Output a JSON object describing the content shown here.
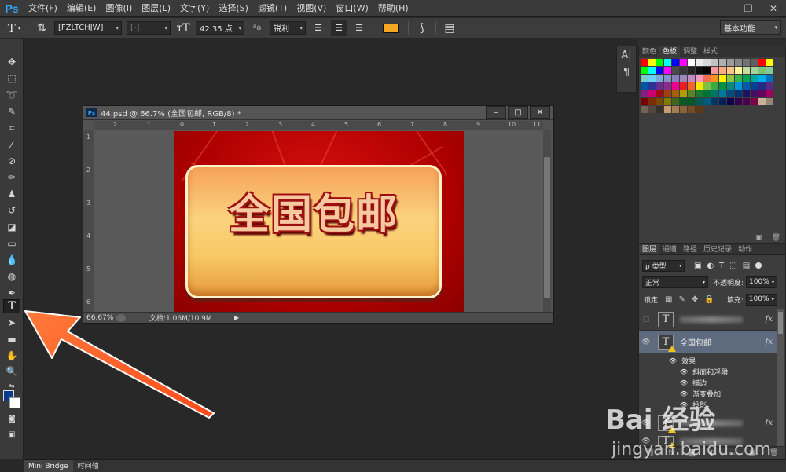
{
  "app": {
    "logo": "Ps"
  },
  "menu": [
    "文件(F)",
    "编辑(E)",
    "图像(I)",
    "图层(L)",
    "文字(Y)",
    "选择(S)",
    "滤镜(T)",
    "视图(V)",
    "窗口(W)",
    "帮助(H)"
  ],
  "window_controls": {
    "minimize": "–",
    "restore": "❐",
    "close": "✕"
  },
  "options": {
    "font_family": "[FZLTCHJW]",
    "font_style": "[-]",
    "font_size": "42.35 点",
    "aa_label": "ªa",
    "antialias": "锐利",
    "swatch_color": "#f5a623",
    "workspace": "基本功能"
  },
  "document": {
    "title": "44.psd @ 66.7% (全国包邮, RGB/8) *",
    "ruler_h": [
      "2",
      "1",
      "0",
      "1",
      "2",
      "3",
      "4",
      "5",
      "6",
      "7",
      "8",
      "9",
      "10",
      "11"
    ],
    "ruler_v": [
      "1",
      "2",
      "3",
      "4",
      "5",
      "6"
    ],
    "zoom": "66.67%",
    "doc_size": "文档:1.06M/10.9M",
    "art_text": "全国包邮"
  },
  "colors": {
    "foreground": "#0b3b8c",
    "background": "#ffffff"
  },
  "swatches_panel": {
    "tabs": [
      "颜色",
      "色板",
      "调整",
      "样式"
    ],
    "active_tab": 1,
    "swatches": [
      "#ff0000",
      "#ffff00",
      "#00ff00",
      "#00ffff",
      "#0000ff",
      "#ff00ff",
      "#ffffff",
      "#ebebeb",
      "#d7d7d7",
      "#c3c3c3",
      "#afafaf",
      "#9b9b9b",
      "#878787",
      "#737373",
      "#5f5f5f",
      "#ff0000",
      "#ffff00",
      "#00ff00",
      "#00ffff",
      "#0000ff",
      "#ff00ff",
      "#4b4b4b",
      "#373737",
      "#232323",
      "#0f0f0f",
      "#000000",
      "#f6989d",
      "#f9ad81",
      "#fdc68a",
      "#fff799",
      "#c4df9b",
      "#a3d39c",
      "#7cc576",
      "#82ca9c",
      "#7accc8",
      "#6dcff6",
      "#7da7d9",
      "#8393ca",
      "#8781bd",
      "#a186be",
      "#bd8cbf",
      "#f49ac2",
      "#f26c4f",
      "#f7941d",
      "#fff200",
      "#8dc73f",
      "#39b54a",
      "#00a651",
      "#00a99d",
      "#00aeef",
      "#0072bc",
      "#0054a6",
      "#2e3192",
      "#662d91",
      "#92278f",
      "#ec008c",
      "#ed1c24",
      "#f26522",
      "#ffe600",
      "#7cbf45",
      "#3aa845",
      "#009344",
      "#008b80",
      "#0095da",
      "#005aab",
      "#003f95",
      "#262a80",
      "#562b86",
      "#821d82",
      "#cc0070",
      "#9e0b0f",
      "#a0410d",
      "#a36209",
      "#aba000",
      "#598527",
      "#1a7b30",
      "#007236",
      "#00746b",
      "#0076a3",
      "#004b80",
      "#003471",
      "#1b1464",
      "#440e62",
      "#630460",
      "#9e005d",
      "#790000",
      "#7b2e00",
      "#7d4900",
      "#827b00",
      "#406618",
      "#005e20",
      "#005826",
      "#005952",
      "#005b7f",
      "#003663",
      "#002157",
      "#0d004c",
      "#32004b",
      "#4b0049",
      "#7b0046",
      "#c7b299",
      "#998675",
      "#736357",
      "#534741",
      "#37302a",
      "#c69c6d",
      "#a67c52",
      "#8c6239",
      "#754c24",
      "#603913"
    ]
  },
  "layers_panel": {
    "tabs": [
      "图层",
      "通道",
      "路径",
      "历史记录",
      "动作"
    ],
    "active_tab": 0,
    "filter_kind": "ρ 类型",
    "blend_mode": "正常",
    "opacity_label": "不透明度:",
    "opacity": "100%",
    "lock_label": "锁定:",
    "fill_label": "填充:",
    "fill": "100%",
    "selected_layer": "全国包邮",
    "effects_label": "效果",
    "effects": [
      "斜面和浮雕",
      "描边",
      "渐变叠加",
      "投影"
    ],
    "fx": "fx"
  },
  "bottom_tabs": [
    "Mini Bridge",
    "时间轴"
  ],
  "watermark": {
    "brand": "Bai 经验",
    "url": "jingyan.baidu.com"
  }
}
